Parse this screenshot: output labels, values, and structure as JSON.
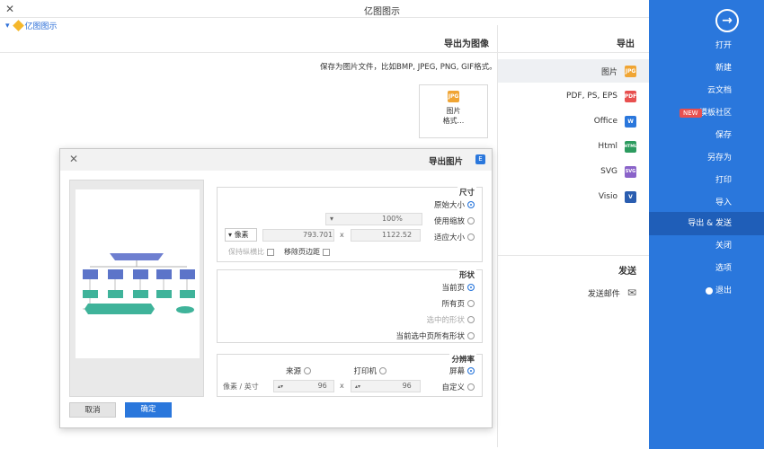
{
  "window": {
    "title": "亿图图示",
    "close_glyph": "✕",
    "breadcrumb": "亿图图示"
  },
  "sidebar": {
    "back_glyph": "→",
    "items": [
      {
        "label": "打开"
      },
      {
        "label": "新建"
      },
      {
        "label": "云文档"
      },
      {
        "label": "模板社区",
        "badge": "NEW"
      },
      {
        "label": "保存"
      },
      {
        "label": "另存为"
      },
      {
        "label": "打印"
      },
      {
        "label": "导入"
      },
      {
        "label": "导出 & 发送"
      },
      {
        "label": "关闭"
      },
      {
        "label": "选项"
      },
      {
        "label": "退出"
      }
    ]
  },
  "export": {
    "heading": "导出",
    "formats": [
      {
        "label": "图片",
        "icon": "JPG",
        "color": "#f0a534"
      },
      {
        "label": "PDF, PS, EPS",
        "icon": "PDF",
        "color": "#e8504f"
      },
      {
        "label": "Office",
        "icon": "W",
        "color": "#2a77dc"
      },
      {
        "label": "Html",
        "icon": "HTML",
        "color": "#2c9b5f"
      },
      {
        "label": "SVG",
        "icon": "SVG",
        "color": "#8a63c9"
      },
      {
        "label": "Visio",
        "icon": "V",
        "color": "#2a5db0"
      }
    ],
    "send_heading": "发送",
    "send_item": "发送邮件"
  },
  "main": {
    "title": "导出为图像",
    "description": "保存为图片文件，比如BMP, JPEG, PNG, GIF格式。",
    "card_icon": "JPG",
    "card_label_1": "图片",
    "card_label_2": "格式..."
  },
  "dialog": {
    "title": "导出图片",
    "title_icon": "E",
    "size": {
      "title": "尺寸",
      "opt_original": "原始大小",
      "opt_zoom": "使用缩放",
      "zoom_value": "100%",
      "opt_fit": "适应大小",
      "width": "1122.52",
      "height": "793.701",
      "times": "x",
      "unit": "像素",
      "keep_ratio": "保持纵横比",
      "remove_margin": "移除页边距"
    },
    "shape": {
      "title": "形状",
      "opt_current": "当前页",
      "opt_all": "所有页",
      "opt_selected": "选中的形状",
      "opt_current_all": "当前选中页所有形状"
    },
    "resolution": {
      "title": "分辨率",
      "opt_screen": "屏幕",
      "opt_printer": "打印机",
      "opt_source": "来源",
      "opt_custom": "自定义",
      "x_value": "96",
      "y_value": "96",
      "unit": "像素 / 英寸"
    },
    "ok": "确定",
    "cancel": "取消"
  }
}
